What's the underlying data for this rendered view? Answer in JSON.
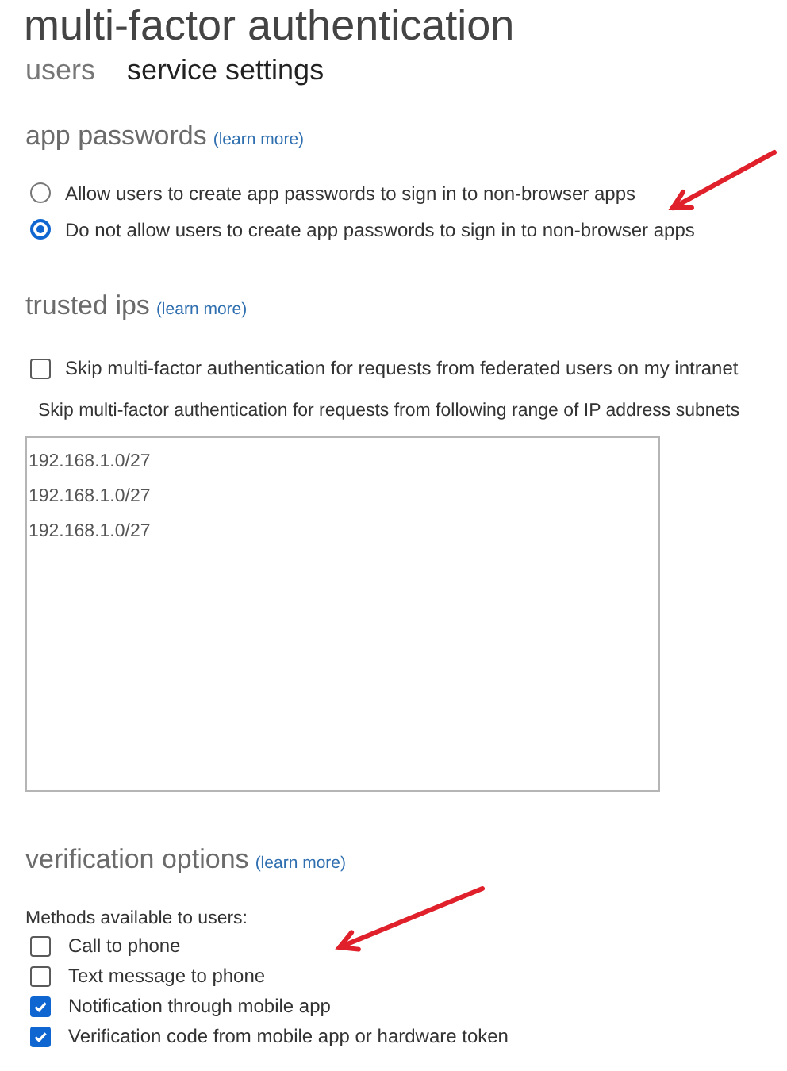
{
  "title": "multi-factor authentication",
  "tabs": [
    {
      "label": "users",
      "selected": false
    },
    {
      "label": "service settings",
      "selected": true
    }
  ],
  "app_passwords": {
    "heading": "app passwords",
    "link": "(learn more)",
    "options": [
      {
        "label": "Allow users to create app passwords to sign in to non-browser apps",
        "selected": false
      },
      {
        "label": "Do not allow users to create app passwords to sign in to non-browser apps",
        "selected": true
      }
    ]
  },
  "trusted_ips": {
    "heading": "trusted ips",
    "link": "(learn more)",
    "federated": {
      "label": "Skip multi-factor authentication for requests from federated users on my intranet",
      "checked": false
    },
    "subnets_label": "Skip multi-factor authentication for requests from following range of IP address subnets",
    "subnets": [
      "192.168.1.0/27",
      "192.168.1.0/27",
      "192.168.1.0/27"
    ]
  },
  "verification_options": {
    "heading": "verification options",
    "link": "(learn more)",
    "methods_label": "Methods available to users:",
    "methods": [
      {
        "label": "Call to phone",
        "checked": false
      },
      {
        "label": "Text message to phone",
        "checked": false
      },
      {
        "label": "Notification through mobile app",
        "checked": true
      },
      {
        "label": "Verification code from mobile app or hardware token",
        "checked": true
      }
    ]
  }
}
